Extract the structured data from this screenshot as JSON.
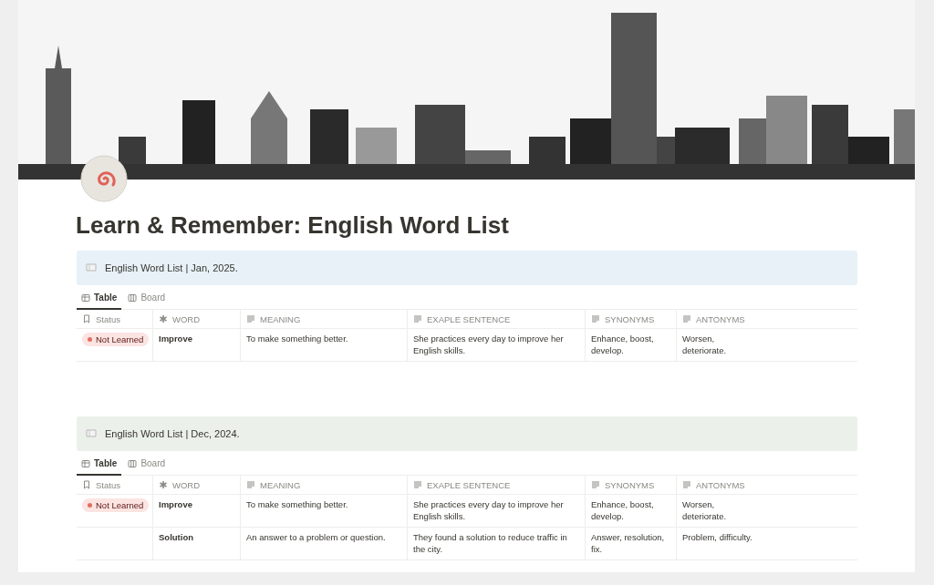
{
  "page": {
    "title": "Learn & Remember: English Word List"
  },
  "sections": [
    {
      "callout": {
        "text": "English Word List | Jan, 2025.",
        "color": "#e8f1f7"
      },
      "tabs": [
        {
          "label": "Table",
          "kind": "table",
          "selected": true
        },
        {
          "label": "Board",
          "kind": "board",
          "selected": false
        }
      ],
      "columns": [
        {
          "label": "Status",
          "kind": "status"
        },
        {
          "label": "WORD",
          "kind": "title"
        },
        {
          "label": "MEANING",
          "kind": "text"
        },
        {
          "label": "EXAPLE SENTENCE",
          "kind": "text"
        },
        {
          "label": "SYNONYMS",
          "kind": "text"
        },
        {
          "label": "ANTONYMS",
          "kind": "text"
        }
      ],
      "rows": [
        {
          "cells": [
            "Not Learned",
            "Improve",
            "To make something better.",
            "She practices every day to improve her English skills.",
            "Enhance, boost, develop.",
            "Worsen, deteriorate."
          ]
        }
      ]
    },
    {
      "callout": {
        "text": "English Word List | Dec, 2024.",
        "color": "#ebf0ea"
      },
      "tabs": [
        {
          "label": "Table",
          "kind": "table",
          "selected": true
        },
        {
          "label": "Board",
          "kind": "board",
          "selected": false
        }
      ],
      "columns": [
        {
          "label": "Status",
          "kind": "status"
        },
        {
          "label": "WORD",
          "kind": "title"
        },
        {
          "label": "MEANING",
          "kind": "text"
        },
        {
          "label": "EXAPLE SENTENCE",
          "kind": "text"
        },
        {
          "label": "SYNONYMS",
          "kind": "text"
        },
        {
          "label": "ANTONYMS",
          "kind": "text"
        }
      ],
      "rows": [
        {
          "cells": [
            "Not Learned",
            "Improve",
            "To make something better.",
            "She practices every day to improve her English skills.",
            "Enhance, boost, develop.",
            "Worsen, deteriorate."
          ]
        },
        {
          "cells": [
            "",
            "Solution",
            "An answer to a problem or question.",
            "They found a solution to reduce traffic in the city.",
            "Answer, resolution, fix.",
            "Problem, difficulty."
          ]
        }
      ]
    }
  ]
}
